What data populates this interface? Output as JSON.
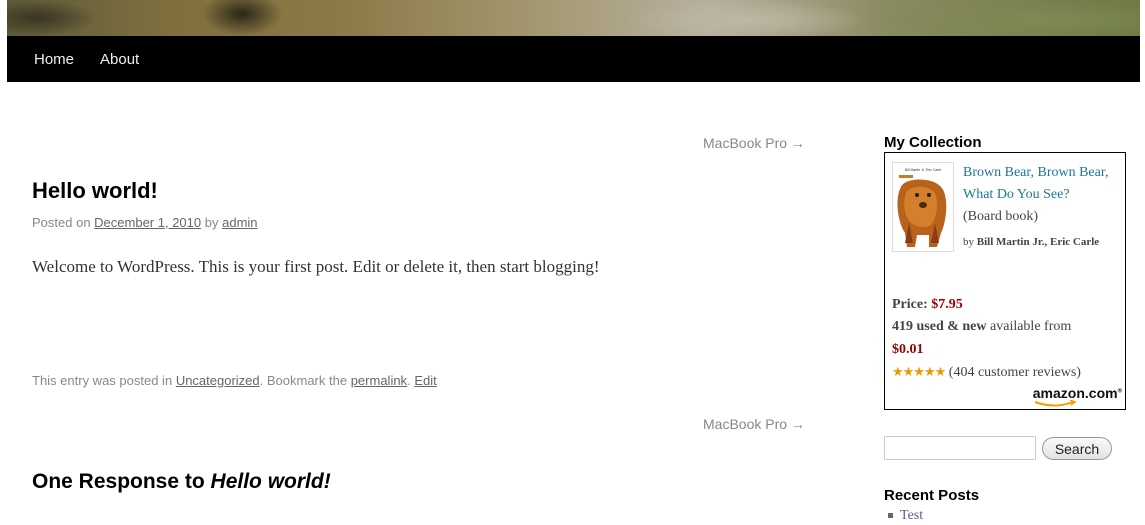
{
  "nav": {
    "home": "Home",
    "about": "About"
  },
  "post_nav": {
    "next": "MacBook Pro →"
  },
  "post": {
    "title": "Hello world!",
    "meta": {
      "posted_on": "Posted on",
      "date": "December 1, 2010",
      "by": "by",
      "author": "admin"
    },
    "content": "Welcome to WordPress. This is your first post. Edit or delete it, then start blogging!",
    "utility": {
      "prefix": "This entry was posted in",
      "category": "Uncategorized",
      "bookmark": ". Bookmark the",
      "permalink": "permalink",
      "sep": ".",
      "edit": "Edit"
    }
  },
  "responses": {
    "prefix": "One Response to",
    "title": "Hello world!"
  },
  "sidebar": {
    "collection": {
      "title": "My Collection",
      "book": {
        "cover_text": "Bill Martin Jr. Eric Carle",
        "title": "Brown Bear, Brown Bear, What Do You See?",
        "binding": "(Board book)",
        "by": "by",
        "authors": "Bill Martin Jr., Eric Carle",
        "price_label": "Price:",
        "price": "$7.95",
        "used_count": "419 used & new",
        "available": "available from",
        "used_price": "$0.01",
        "stars": "★★★★★",
        "reviews": "(404 customer reviews)",
        "logo": "amazon.com"
      }
    },
    "search": {
      "button": "Search",
      "value": ""
    },
    "recent": {
      "title": "Recent Posts",
      "items": [
        "Test"
      ]
    }
  }
}
